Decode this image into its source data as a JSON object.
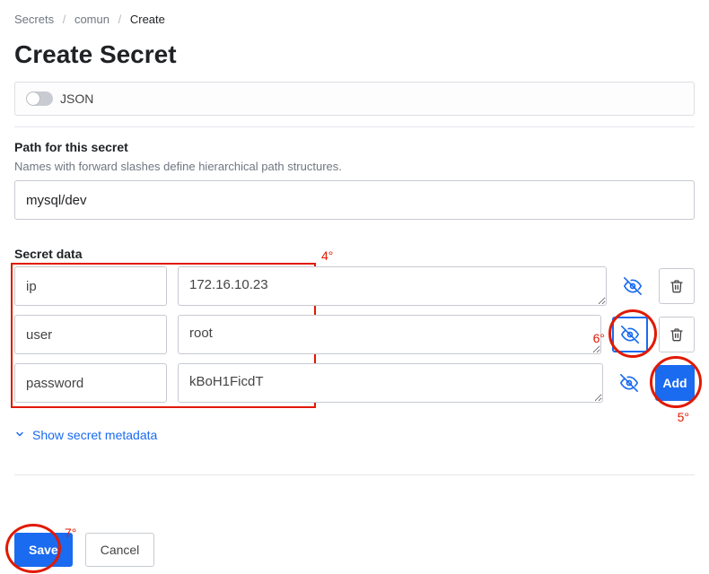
{
  "breadcrumb": {
    "root": "Secrets",
    "mid": "comun",
    "current": "Create"
  },
  "title": "Create Secret",
  "json_toggle": {
    "label": "JSON",
    "on": false
  },
  "path_section": {
    "label": "Path for this secret",
    "helper": "Names with forward slashes define hierarchical path structures.",
    "value": "mysql/dev"
  },
  "secret_data": {
    "label": "Secret data",
    "rows": [
      {
        "key": "ip",
        "value": "172.16.10.23",
        "masked": false
      },
      {
        "key": "user",
        "value": "root",
        "masked": false
      },
      {
        "key": "password",
        "value": "kBoH1FicdT",
        "masked": false
      }
    ],
    "add_label": "Add"
  },
  "metadata_link": "Show secret metadata",
  "footer": {
    "save": "Save",
    "cancel": "Cancel"
  },
  "annotations": {
    "box_label": "4°",
    "add_label": "5°",
    "eye_label": "6°",
    "save_label": "7°"
  }
}
